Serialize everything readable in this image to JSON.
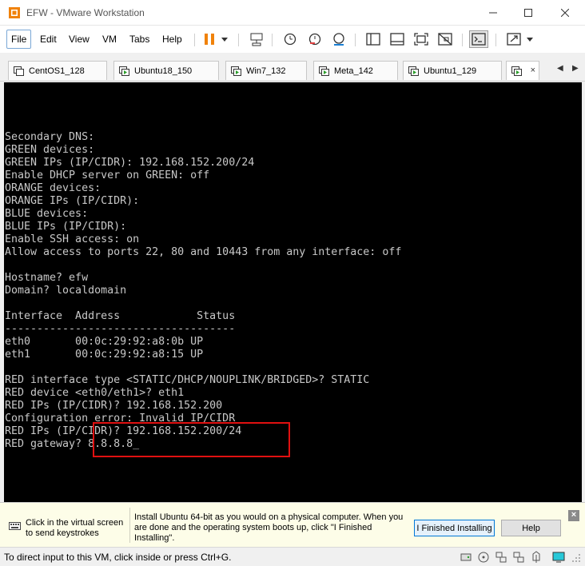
{
  "window": {
    "title": "EFW - VMware Workstation"
  },
  "menu": {
    "items": [
      "File",
      "Edit",
      "View",
      "VM",
      "Tabs",
      "Help"
    ]
  },
  "tabs": {
    "items": [
      {
        "label": "CentOS1_128"
      },
      {
        "label": "Ubuntu18_150"
      },
      {
        "label": "Win7_132"
      },
      {
        "label": "Meta_142"
      },
      {
        "label": "Ubuntu1_129"
      }
    ],
    "active_close": "×"
  },
  "console": {
    "lines": [
      "Secondary DNS:",
      "GREEN devices:",
      "GREEN IPs (IP/CIDR): 192.168.152.200/24",
      "Enable DHCP server on GREEN: off",
      "ORANGE devices:",
      "ORANGE IPs (IP/CIDR):",
      "BLUE devices:",
      "BLUE IPs (IP/CIDR):",
      "Enable SSH access: on",
      "Allow access to ports 22, 80 and 10443 from any interface: off",
      "",
      "Hostname? efw",
      "Domain? localdomain",
      "",
      "Interface  Address            Status",
      "------------------------------------",
      "eth0       00:0c:29:92:a8:0b UP",
      "eth1       00:0c:29:92:a8:15 UP",
      "",
      "RED interface type <STATIC/DHCP/NOUPLINK/BRIDGED>? STATIC",
      "RED device <eth0/eth1>? eth1",
      "RED IPs (IP/CIDR)? 192.168.152.200",
      "Configuration error: Invalid IP/CIDR",
      "RED IPs (IP/CIDR)? 192.168.152.200/24",
      "RED gateway? 8.8.8.8_"
    ]
  },
  "hint": {
    "left_text": "Click in the virtual screen to send keystrokes",
    "main_text": "Install Ubuntu 64-bit as you would on a physical computer. When you are done and the operating system boots up, click \"I Finished Installing\".",
    "finished_button": "I Finished Installing",
    "help_button": "Help",
    "close": "×"
  },
  "status": {
    "text": "To direct input to this VM, click inside or press Ctrl+G."
  },
  "colors": {
    "accent": "#f0820a",
    "console_bg": "#000000",
    "console_text": "#c8c8c8",
    "highlight": "#e01010",
    "hint_bg": "#fdfde8"
  }
}
